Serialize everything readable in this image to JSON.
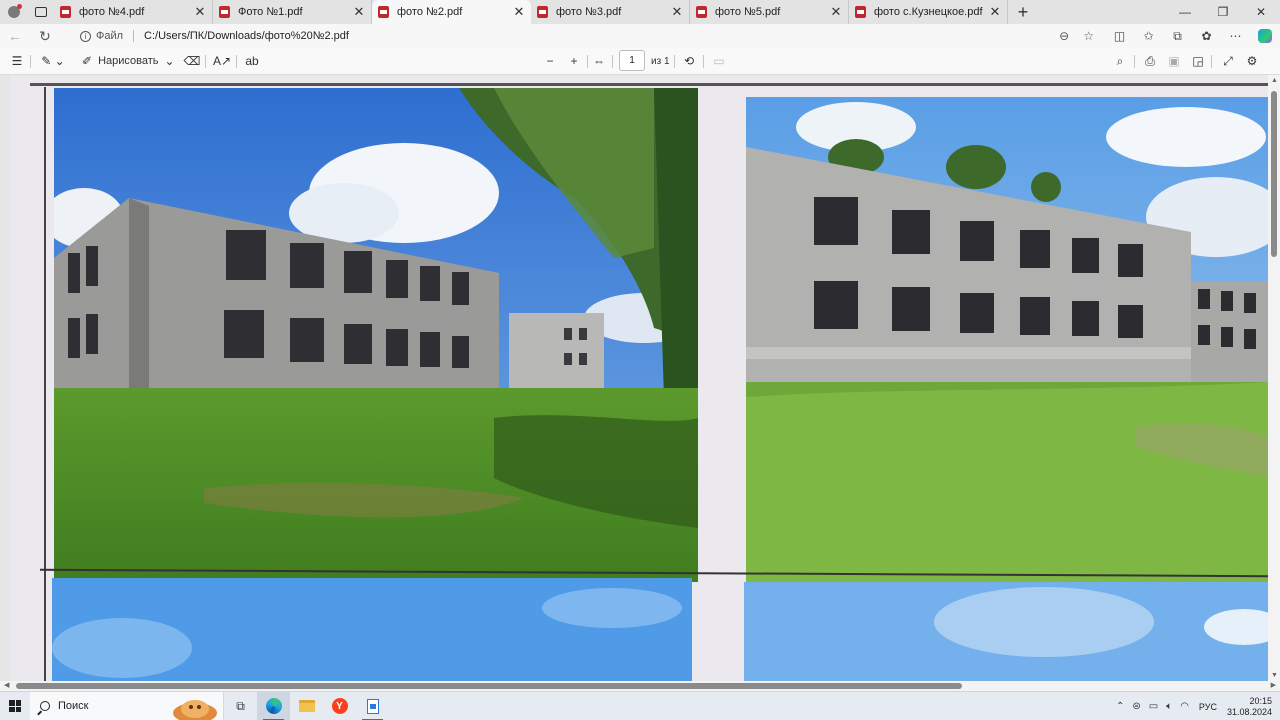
{
  "tabs": [
    {
      "label": "фото №4.pdf",
      "active": false
    },
    {
      "label": "Фото №1.pdf",
      "active": false
    },
    {
      "label": "фото №2.pdf",
      "active": true
    },
    {
      "label": "фото №3.pdf",
      "active": false
    },
    {
      "label": "фото №5.pdf",
      "active": false
    },
    {
      "label": "фото с.Кузнецкое.pdf",
      "active": false
    }
  ],
  "address": {
    "scheme_label": "Файл",
    "url": "C:/Users/ПК/Downloads/фото%20№2.pdf"
  },
  "pdf_toolbar": {
    "draw_label": "Нарисовать",
    "page_number": "1",
    "page_count": "из 1"
  },
  "taskbar": {
    "search_placeholder": "Поиск",
    "language": "РУС",
    "time": "20:15",
    "date": "31.08.2024"
  },
  "colors": {
    "accent": "#2a6fd8",
    "pdf_icon": "#c4262e",
    "sky": "#3f86d6",
    "grass": "#4f8f2a"
  },
  "icons": {
    "tab": "pdf-file-icon",
    "nav": [
      "back-arrow-icon",
      "refresh-icon"
    ],
    "browser": [
      "split-screen-icon",
      "favorites-icon",
      "collections-icon",
      "extensions-icon",
      "more-icon",
      "copilot-icon"
    ]
  }
}
